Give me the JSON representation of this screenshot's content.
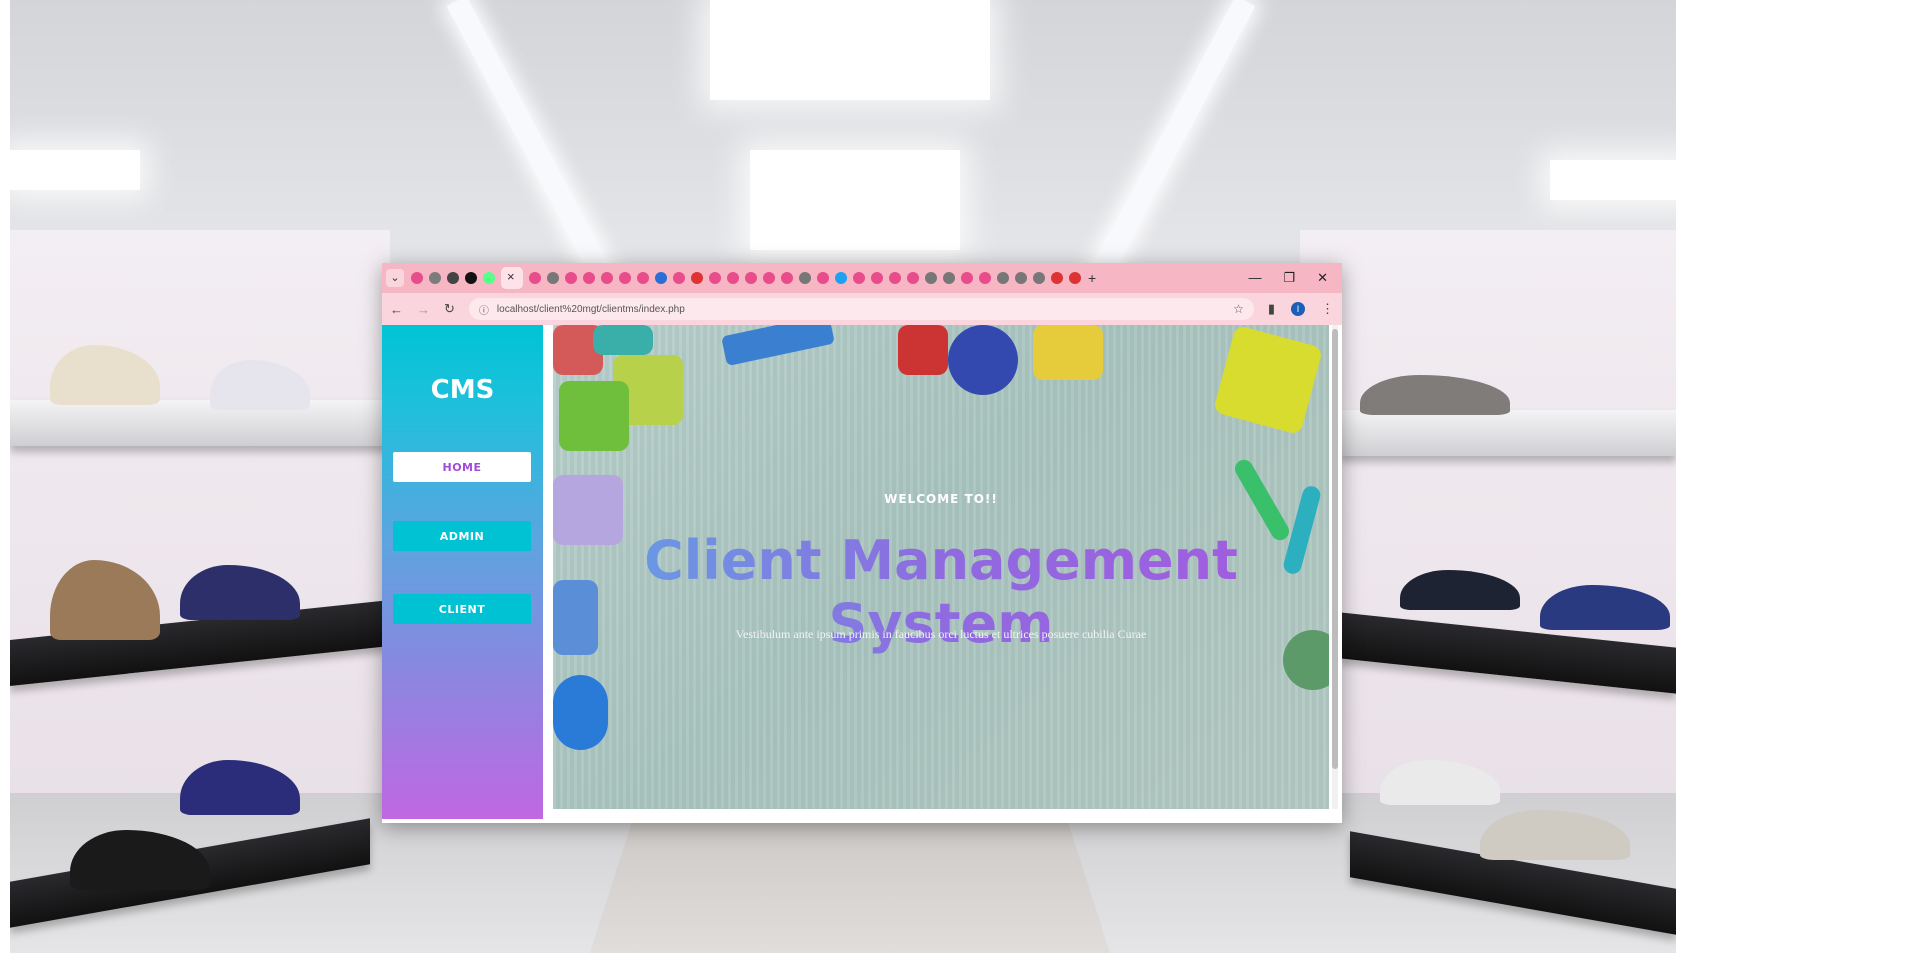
{
  "browser": {
    "tab_close": "×",
    "new_tab": "+",
    "window_controls": {
      "minimize": "—",
      "restore": "❐",
      "close": "✕"
    },
    "url": "localhost/client%20mgt/clientms/index.php",
    "profile_initial": "I"
  },
  "sidebar": {
    "brand": "CMS",
    "nav": [
      {
        "label": "HOME",
        "active": true
      },
      {
        "label": "ADMIN",
        "active": false
      },
      {
        "label": "CLIENT",
        "active": false
      }
    ]
  },
  "hero": {
    "welcome": "WELCOME TO!!",
    "title": "Client Management System",
    "subtitle": "Vestibulum ante ipsum primis in faucibus orci luctus et ultrices posuere cubilia Curae"
  },
  "colors": {
    "tabbar": "#f7b6c4",
    "sidebar_top": "#00c4d6",
    "sidebar_bottom": "#c067e2",
    "accent_button": "#00c2d2",
    "headline_gradient": [
      "#5ea6e4",
      "#a55ae0"
    ]
  }
}
